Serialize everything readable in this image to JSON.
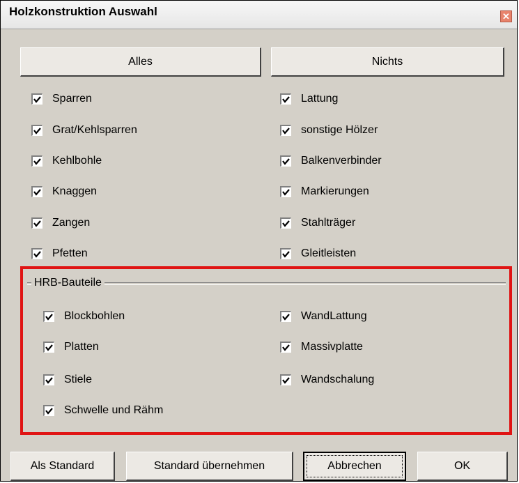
{
  "window": {
    "title": "Holzkonstruktion Auswahl",
    "close_glyph": "✕"
  },
  "top_buttons": {
    "all": "Alles",
    "none": "Nichts"
  },
  "left_items": [
    "Sparren",
    "Grat/Kehlsparren",
    "Kehlbohle",
    "Knaggen",
    "Zangen",
    "Pfetten"
  ],
  "right_items": [
    "Lattung",
    "sonstige Hölzer",
    "Balkenverbinder",
    "Markierungen",
    "Stahlträger",
    "Gleitleisten"
  ],
  "hrb_group": {
    "label": "HRB-Bauteile",
    "left_items": [
      "Blockbohlen",
      "Platten",
      "Stiele",
      "Schwelle und Rähm"
    ],
    "right_items": [
      "WandLattung",
      "Massivplatte",
      "Wandschalung"
    ]
  },
  "bottom_buttons": {
    "set_default": "Als Standard",
    "apply_default": "Standard übernehmen",
    "cancel": "Abbrechen",
    "ok": "OK"
  },
  "checked_all": true,
  "colors": {
    "highlight": "#e01414",
    "dialog_bg": "#d4d0c8"
  }
}
